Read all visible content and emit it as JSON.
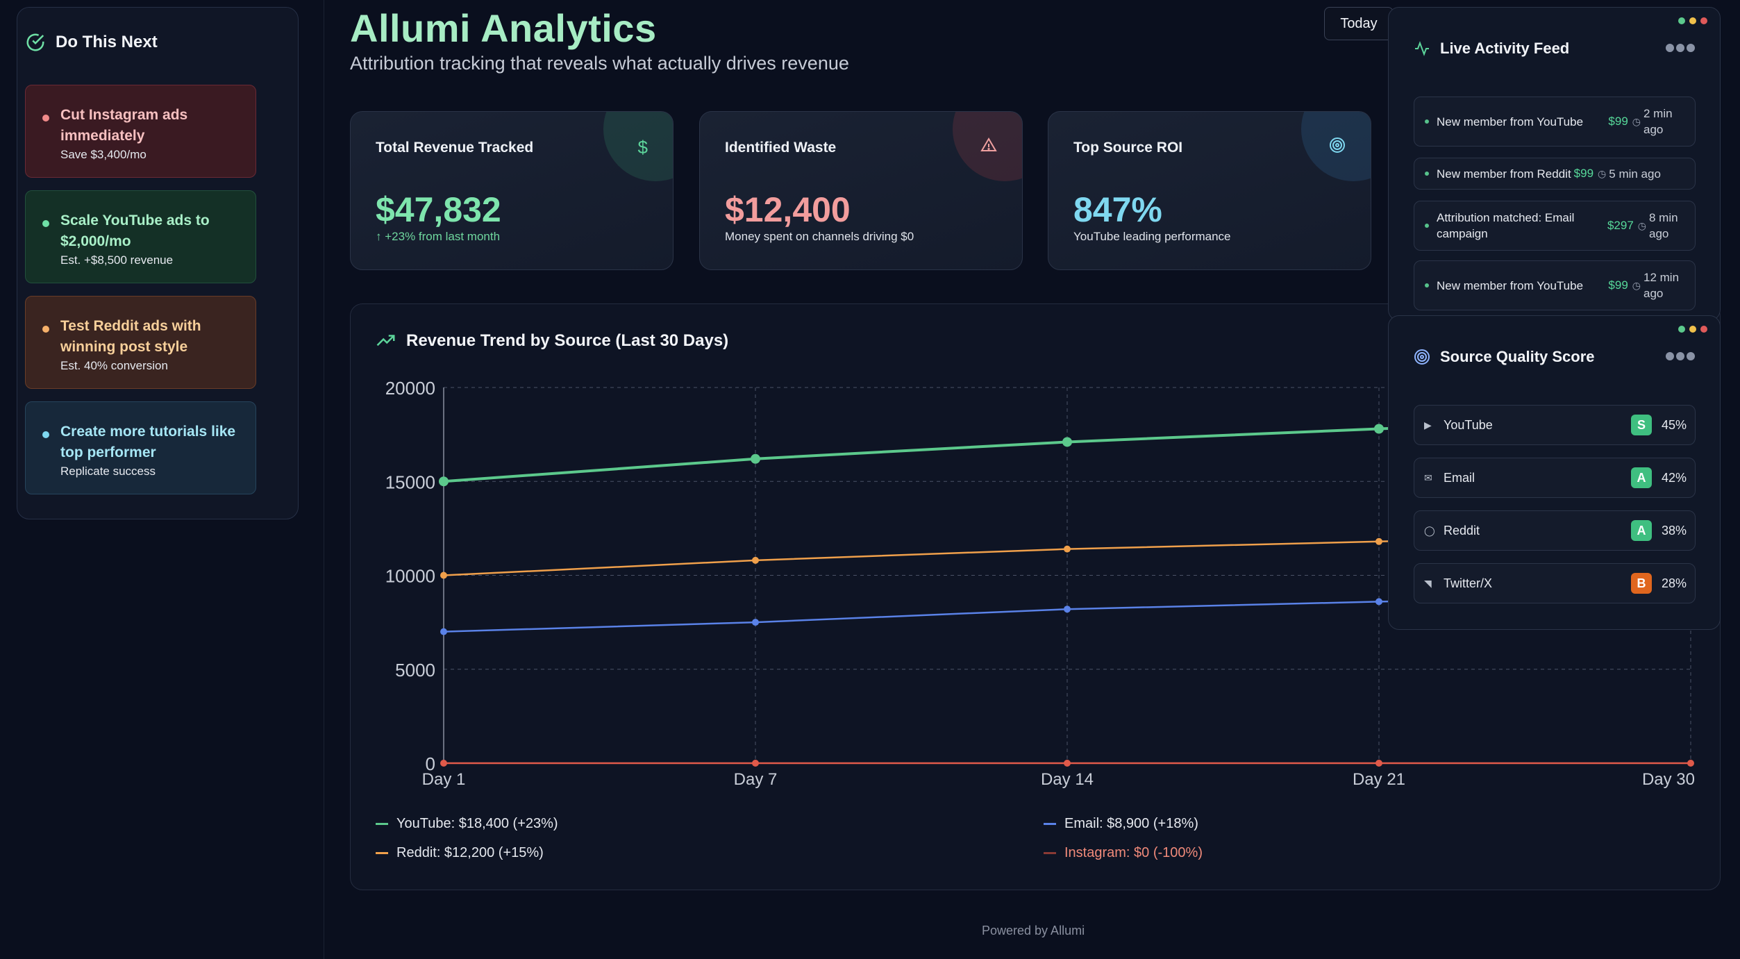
{
  "colors": {
    "youtube": "#5cc98c",
    "reddit": "#f0a04b",
    "email": "#5a82e8",
    "instagram": "#e05a4a",
    "grade_s": "#3fbf80",
    "grade_a": "#3fbf80",
    "grade_b": "#e0661e"
  },
  "next": {
    "title": "Do This Next",
    "items": [
      {
        "title": "Cut Instagram ads immediately",
        "sub": "Save $3,400/mo"
      },
      {
        "title": "Scale YouTube ads to $2,000/mo",
        "sub": "Est. +$8,500 revenue"
      },
      {
        "title": "Test Reddit ads with winning post style",
        "sub": "Est. 40% conversion"
      },
      {
        "title": "Create more tutorials like top performer",
        "sub": "Replicate success"
      }
    ]
  },
  "header": {
    "title": "Allumi Analytics",
    "subtitle": "Attribution tracking that reveals what actually drives revenue",
    "today": "Today"
  },
  "kpis": [
    {
      "label": "Total Revenue Tracked",
      "value": "$47,832",
      "sub": "+23% from last month",
      "icon": "dollar-icon"
    },
    {
      "label": "Identified Waste",
      "value": "$12,400",
      "sub": "Money spent on channels driving $0",
      "icon": "warning-icon"
    },
    {
      "label": "Top Source ROI",
      "value": "847%",
      "sub": "YouTube leading performance",
      "icon": "target-icon"
    }
  ],
  "chart": {
    "title": "Revenue Trend by Source (Last 30 Days)",
    "legend": [
      "YouTube: $18,400 (+23%)",
      "Email: $8,900 (+18%)",
      "Reddit: $12,200 (+15%)",
      "Instagram: $0 (-100%)"
    ]
  },
  "chart_data": {
    "type": "line",
    "title": "Revenue Trend by Source (Last 30 Days)",
    "x": [
      "Day 1",
      "Day 7",
      "Day 14",
      "Day 21",
      "Day 30"
    ],
    "ylim": [
      0,
      20000
    ],
    "yticks": [
      0,
      5000,
      10000,
      15000,
      20000
    ],
    "grid": true,
    "legend_position": "bottom",
    "series": [
      {
        "name": "YouTube",
        "color": "#5cc98c",
        "values": [
          15000,
          16200,
          17100,
          17800,
          18400
        ]
      },
      {
        "name": "Reddit",
        "color": "#f0a04b",
        "values": [
          10000,
          10800,
          11400,
          11800,
          12200
        ]
      },
      {
        "name": "Email",
        "color": "#5a82e8",
        "values": [
          7000,
          7500,
          8200,
          8600,
          8900
        ]
      },
      {
        "name": "Instagram",
        "color": "#e05a4a",
        "values": [
          0,
          0,
          0,
          0,
          0
        ]
      }
    ]
  },
  "feed": {
    "title": "Live Activity Feed",
    "items": [
      {
        "msg": "New member from YouTube",
        "amount": "$99",
        "time": "2 min ago"
      },
      {
        "msg": "New member from Reddit",
        "amount": "$99",
        "time": "5 min ago"
      },
      {
        "msg": "Attribution matched: Email campaign",
        "amount": "$297",
        "time": "8 min ago"
      },
      {
        "msg": "New member from YouTube",
        "amount": "$99",
        "time": "12 min ago"
      }
    ]
  },
  "quality": {
    "title": "Source Quality Score",
    "items": [
      {
        "name": "YouTube",
        "grade": "S",
        "pct": "45%",
        "icon": "youtube-icon"
      },
      {
        "name": "Email",
        "grade": "A",
        "pct": "42%",
        "icon": "mail-icon"
      },
      {
        "name": "Reddit",
        "grade": "A",
        "pct": "38%",
        "icon": "chat-icon"
      },
      {
        "name": "Twitter/X",
        "grade": "B",
        "pct": "28%",
        "icon": "twitter-icon"
      }
    ]
  },
  "footer": "Powered by Allumi"
}
